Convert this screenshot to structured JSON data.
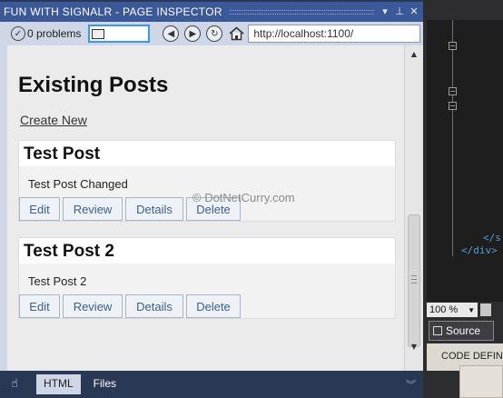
{
  "inspector": {
    "title": "FUN WITH SIGNALR - PAGE INSPECTOR",
    "title_buttons": [
      "▾",
      "⊥",
      "✕"
    ],
    "toolbar": {
      "problems": "0 problems",
      "url": "http://localhost:1100/"
    },
    "page": {
      "heading": "Existing Posts",
      "create_link": "Create New",
      "posts": [
        {
          "title": "Test Post",
          "body": "Test Post Changed"
        },
        {
          "title": "Test Post 2",
          "body": "Test Post 2"
        }
      ],
      "actions": [
        "Edit",
        "Review",
        "Details",
        "Delete"
      ],
      "watermark": "© DotNetCurry.com"
    },
    "bottom_tabs": {
      "html": "HTML",
      "files": "Files"
    }
  },
  "editor": {
    "code_lines": [
      "</s",
      "</div>"
    ],
    "zoom": "100 %",
    "source_tab": "Source",
    "code_definition_title": "CODE DEFINITION"
  },
  "colors": {
    "titlebar": "#3b5998",
    "panel": "#293955",
    "toolbar": "#cfd6e5",
    "link_button_text": "#3b5f8a",
    "editor_bg": "#1e1e1e"
  }
}
